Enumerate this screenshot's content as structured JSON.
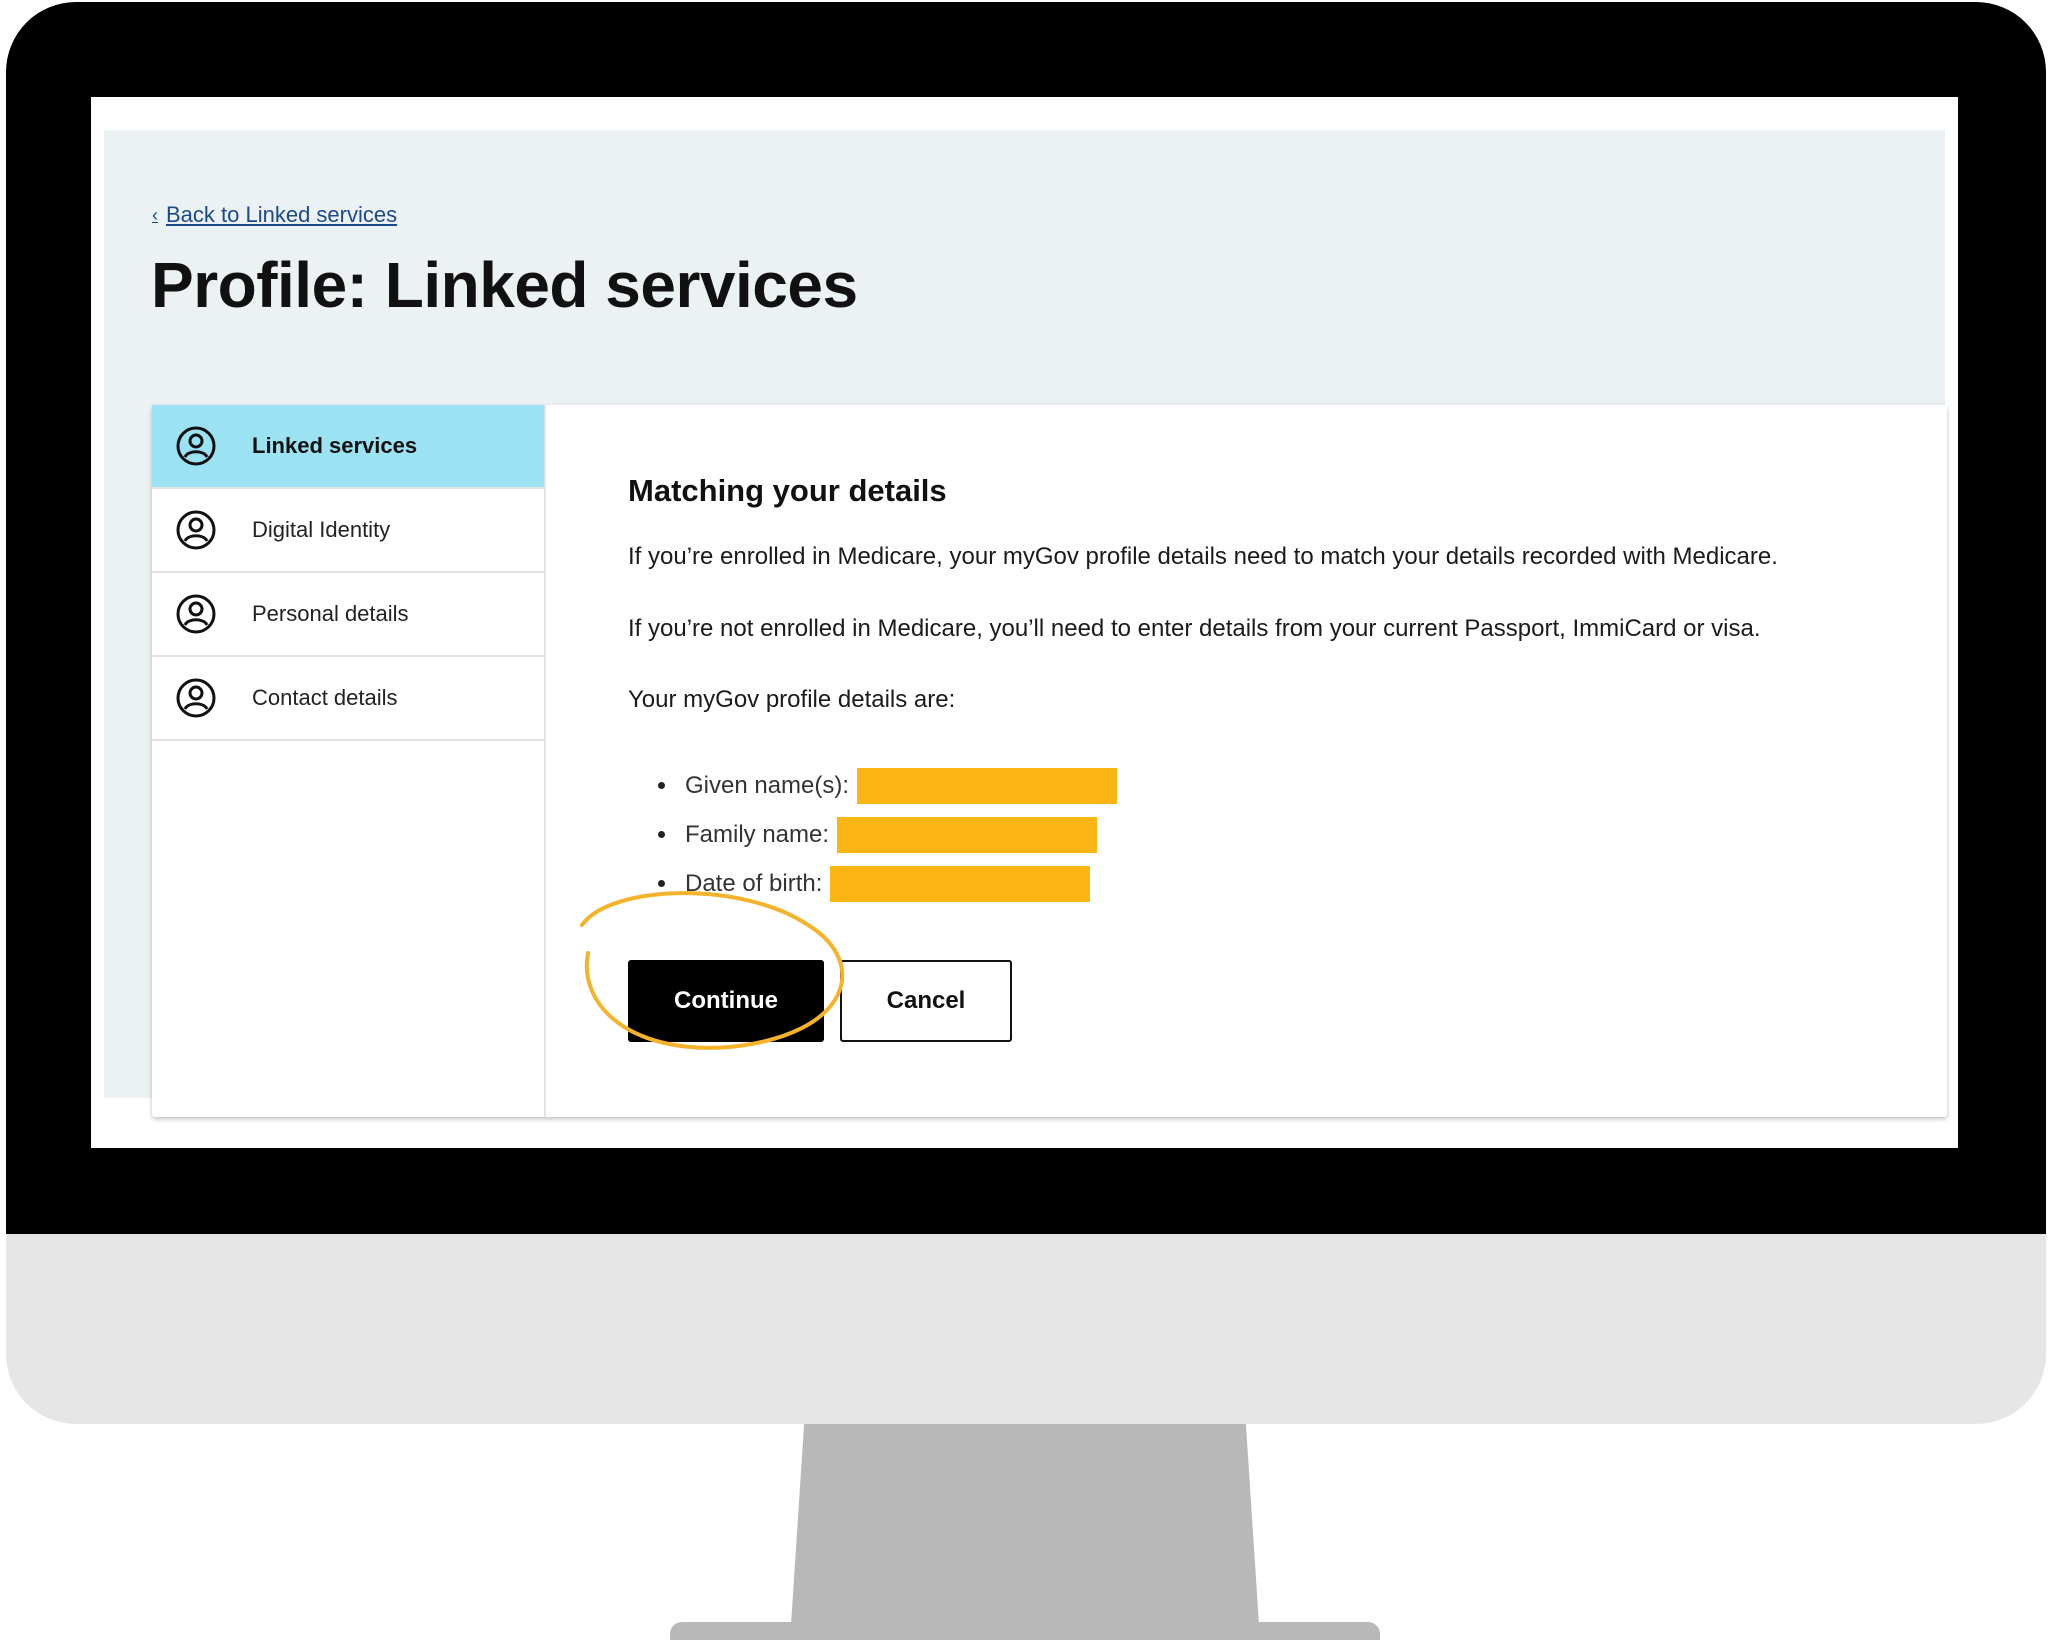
{
  "back_link": {
    "label": "Back to Linked services"
  },
  "page": {
    "title": "Profile: Linked services"
  },
  "sidebar": {
    "items": [
      {
        "label": "Linked services",
        "icon": "user-circle-icon",
        "active": true
      },
      {
        "label": "Digital Identity",
        "icon": "user-circle-icon",
        "active": false
      },
      {
        "label": "Personal details",
        "icon": "user-circle-icon",
        "active": false
      },
      {
        "label": "Contact details",
        "icon": "user-circle-icon",
        "active": false
      }
    ]
  },
  "content": {
    "heading": "Matching your details",
    "paragraph_1": "If you’re enrolled in Medicare, your myGov profile details need to match your details recorded with Medicare.",
    "paragraph_2": "If you’re not enrolled in Medicare, you’ll need to enter details from your current Passport, ImmiCard or visa.",
    "paragraph_3": "Your myGov profile details are:",
    "details": [
      {
        "label": "Given name(s):"
      },
      {
        "label": "Family name:"
      },
      {
        "label": "Date of birth:"
      }
    ],
    "redaction_color": "#fbb615"
  },
  "actions": {
    "continue_label": "Continue",
    "cancel_label": "Cancel"
  },
  "colors": {
    "active_nav": "#9be2f3",
    "highlight_ring": "#f4b32a",
    "primary_button": "#000000"
  }
}
